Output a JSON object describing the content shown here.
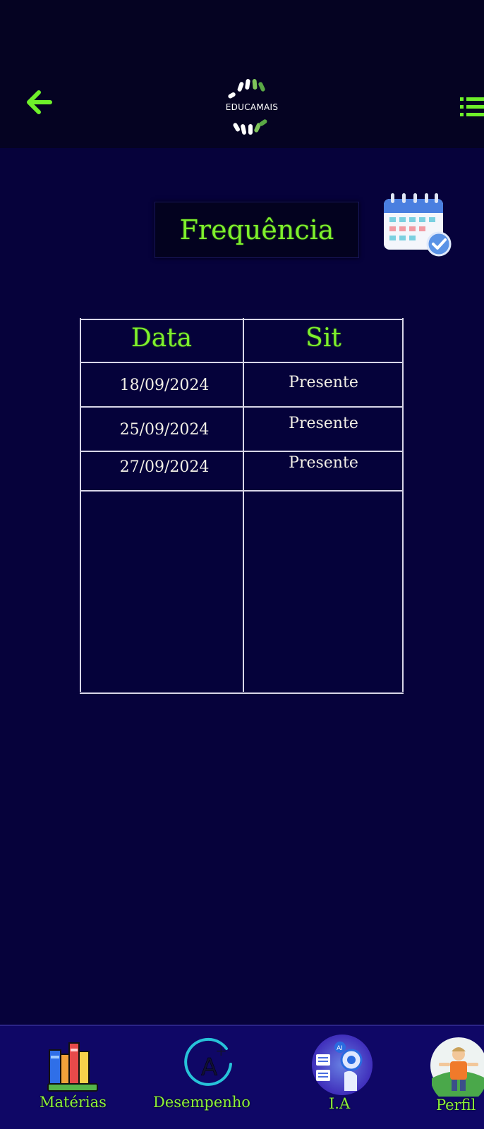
{
  "app": {
    "logo_text": "EDUCAMAIS",
    "accent_color": "#7ef02d"
  },
  "header": {
    "back_icon": "arrow-left-icon",
    "menu_icon": "list-menu-icon"
  },
  "page": {
    "title": "Frequência",
    "title_icon": "calendar-check-icon"
  },
  "attendance_table": {
    "columns": [
      "Data",
      "Sit"
    ],
    "rows": [
      {
        "date": "18/09/2024",
        "status": "Presente"
      },
      {
        "date": "25/09/2024",
        "status": "Presente"
      },
      {
        "date": "27/09/2024",
        "status": "Presente"
      }
    ]
  },
  "bottom_nav": {
    "items": [
      {
        "label": "Matérias",
        "icon": "books-icon"
      },
      {
        "label": "Desempenho",
        "icon": "grade-a-plus-icon"
      },
      {
        "label": "I.A",
        "icon": "ai-robot-icon"
      },
      {
        "label": "Perfil",
        "icon": "profile-avatar-icon"
      }
    ]
  }
}
